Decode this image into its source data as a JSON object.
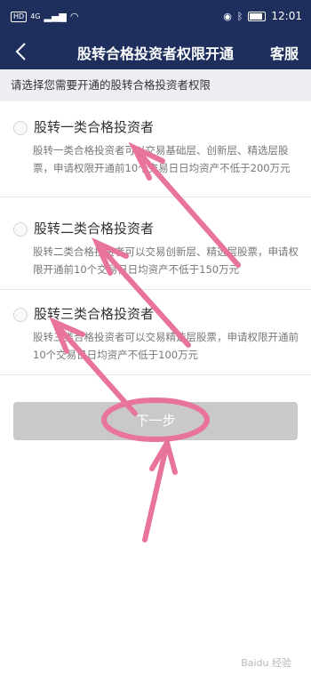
{
  "status": {
    "time": "12:01",
    "network_badge": "HD",
    "signal": "4G"
  },
  "header": {
    "back_icon": "chevron-left-icon",
    "title": "股转合格投资者权限开通",
    "service_label": "客服"
  },
  "prompt": "请选择您需要开通的股转合格投资者权限",
  "options": [
    {
      "title": "股转一类合格投资者",
      "description": "股转一类合格投资者可以交易基础层、创新层、精选层股票，申请权限开通前10个交易日日均资产不低于200万元"
    },
    {
      "title": "股转二类合格投资者",
      "description": "股转二类合格投资者可以交易创新层、精选层股票，申请权限开通前10个交易日日均资产不低于150万元"
    },
    {
      "title": "股转三类合格投资者",
      "description": "股转三类合格投资者可以交易精选层股票，申请权限开通前10个交易日日均资产不低于100万元"
    }
  ],
  "next_button": "下一步",
  "watermark": "Baidu 经验",
  "colors": {
    "header_bg": "#1e2f5e",
    "annotation_pink": "#e8739b",
    "button_disabled": "#c9c9c9"
  }
}
